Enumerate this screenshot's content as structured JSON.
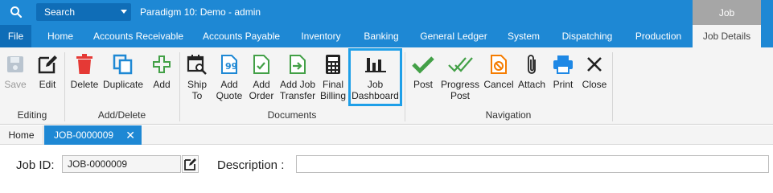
{
  "titlebar": {
    "search_label": "Search",
    "app_title": "Paradigm 10: Demo - admin",
    "context_header": "Job"
  },
  "menu": {
    "items": [
      "File",
      "Home",
      "Accounts Receivable",
      "Accounts Payable",
      "Inventory",
      "Banking",
      "General Ledger",
      "System",
      "Dispatching",
      "Production",
      "Job Details"
    ],
    "active": "Job Details"
  },
  "ribbon": {
    "groups": [
      {
        "label": "Editing",
        "buttons": [
          {
            "label": "Save",
            "icon": "save-icon",
            "enabled": false
          },
          {
            "label": "Edit",
            "icon": "edit-icon",
            "enabled": true
          }
        ]
      },
      {
        "label": "Add/Delete",
        "buttons": [
          {
            "label": "Delete",
            "icon": "trash-icon",
            "enabled": true
          },
          {
            "label": "Duplicate",
            "icon": "duplicate-icon",
            "enabled": true
          },
          {
            "label": "Add",
            "icon": "plus-icon",
            "enabled": true
          }
        ]
      },
      {
        "label": "Documents",
        "buttons": [
          {
            "label": "Ship\nTo",
            "icon": "calendar-search-icon",
            "enabled": true
          },
          {
            "label": "Add\nQuote",
            "icon": "quote-doc-icon",
            "enabled": true
          },
          {
            "label": "Add\nOrder",
            "icon": "order-doc-icon",
            "enabled": true
          },
          {
            "label": "Add Job\nTransfer",
            "icon": "transfer-doc-icon",
            "enabled": true
          },
          {
            "label": "Final\nBilling",
            "icon": "calculator-icon",
            "enabled": true
          },
          {
            "label": "Job\nDashboard",
            "icon": "bar-chart-icon",
            "enabled": true,
            "selected": true
          }
        ]
      },
      {
        "label": "Navigation",
        "buttons": [
          {
            "label": "Post",
            "icon": "checkmark-icon",
            "enabled": true
          },
          {
            "label": "Progress\nPost",
            "icon": "double-check-icon",
            "enabled": true
          },
          {
            "label": "Cancel",
            "icon": "cancel-doc-icon",
            "enabled": true
          },
          {
            "label": "Attach",
            "icon": "paperclip-icon",
            "enabled": true
          },
          {
            "label": "Print",
            "icon": "printer-icon",
            "enabled": true
          },
          {
            "label": "Close",
            "icon": "close-icon",
            "enabled": true
          }
        ]
      }
    ]
  },
  "doctabs": {
    "home_label": "Home",
    "job_tab_label": "JOB-0000009",
    "close_glyph": "✕"
  },
  "form": {
    "job_id_label": "Job ID:",
    "job_id_value": "JOB-0000009",
    "description_label": "Description :",
    "description_value": ""
  },
  "colors": {
    "primary": "#1e88d4",
    "primary_dark": "#0f6db7",
    "context_header": "#a6a6a6",
    "selection_border": "#1e9fe8",
    "delete_red": "#e53935",
    "success_green": "#43a047",
    "orange": "#f57c00",
    "print_blue": "#1e88e5"
  }
}
